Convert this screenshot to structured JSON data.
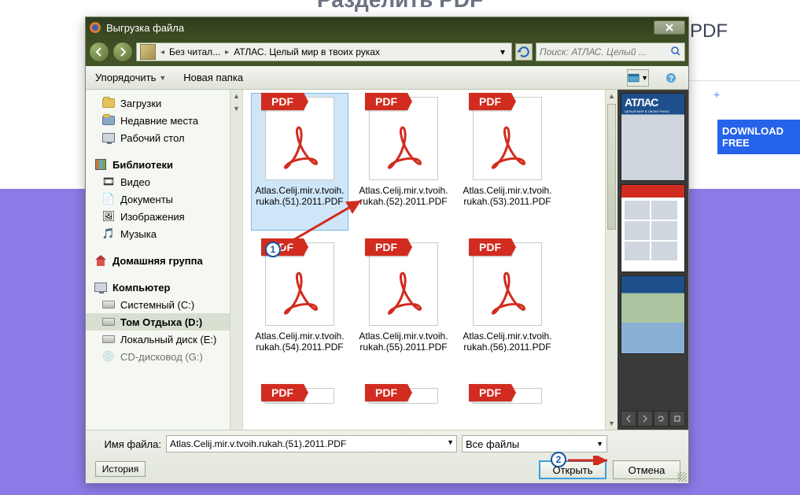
{
  "background": {
    "header_text": "Разделить PDF",
    "side_text": "PDF",
    "download_label": "DOWNLOAD FREE",
    "plus": "+"
  },
  "dialog": {
    "title": "Выгрузка файла",
    "close_icon": "close-icon",
    "address": {
      "part1": "Без читал...",
      "part2": "АТЛАС. Целый мир в твоих руках"
    },
    "search_placeholder": "Поиск: АТЛАС. Целый ...",
    "toolbar": {
      "organize": "Упорядочить",
      "newfolder": "Новая папка"
    },
    "sidebar": {
      "items": [
        {
          "label": "Загрузки",
          "icon": "folder"
        },
        {
          "label": "Недавние места",
          "icon": "recent"
        },
        {
          "label": "Рабочий стол",
          "icon": "desktop"
        }
      ],
      "libraries_header": "Библиотеки",
      "libraries": [
        {
          "label": "Видео"
        },
        {
          "label": "Документы"
        },
        {
          "label": "Изображения"
        },
        {
          "label": "Музыка"
        }
      ],
      "homegroup": "Домашняя группа",
      "computer": "Компьютер",
      "drives": [
        {
          "label": "Системный (C:)"
        },
        {
          "label": "Том Отдыха (D:)",
          "selected": true
        },
        {
          "label": "Локальный диск (E:)"
        },
        {
          "label": "CD-дисковод (G:)"
        }
      ]
    },
    "files": [
      {
        "name": "Atlas.Celij.mir.v.tvoih.rukah.(51).2011.PDF",
        "selected": true
      },
      {
        "name": "Atlas.Celij.mir.v.tvoih.rukah.(52).2011.PDF"
      },
      {
        "name": "Atlas.Celij.mir.v.tvoih.rukah.(53).2011.PDF"
      },
      {
        "name": "Atlas.Celij.mir.v.tvoih.rukah.(54).2011.PDF"
      },
      {
        "name": "Atlas.Celij.mir.v.tvoih.rukah.(55).2011.PDF"
      },
      {
        "name": "Atlas.Celij.mir.v.tvoih.rukah.(56).2011.PDF"
      }
    ],
    "pdf_badge": "PDF",
    "preview": {
      "atlas_title": "АТЛАС",
      "atlas_sub": "ЦЕЛЫЙ МИР В ТВОИХ РУКАХ"
    },
    "bottom": {
      "filename_label": "Имя файла:",
      "filename_value": "Atlas.Celij.mir.v.tvoih.rukah.(51).2011.PDF",
      "filetype": "Все файлы",
      "open": "Открыть",
      "cancel": "Отмена",
      "history": "История"
    }
  },
  "annotations": {
    "badge1": "1",
    "badge2": "2"
  }
}
